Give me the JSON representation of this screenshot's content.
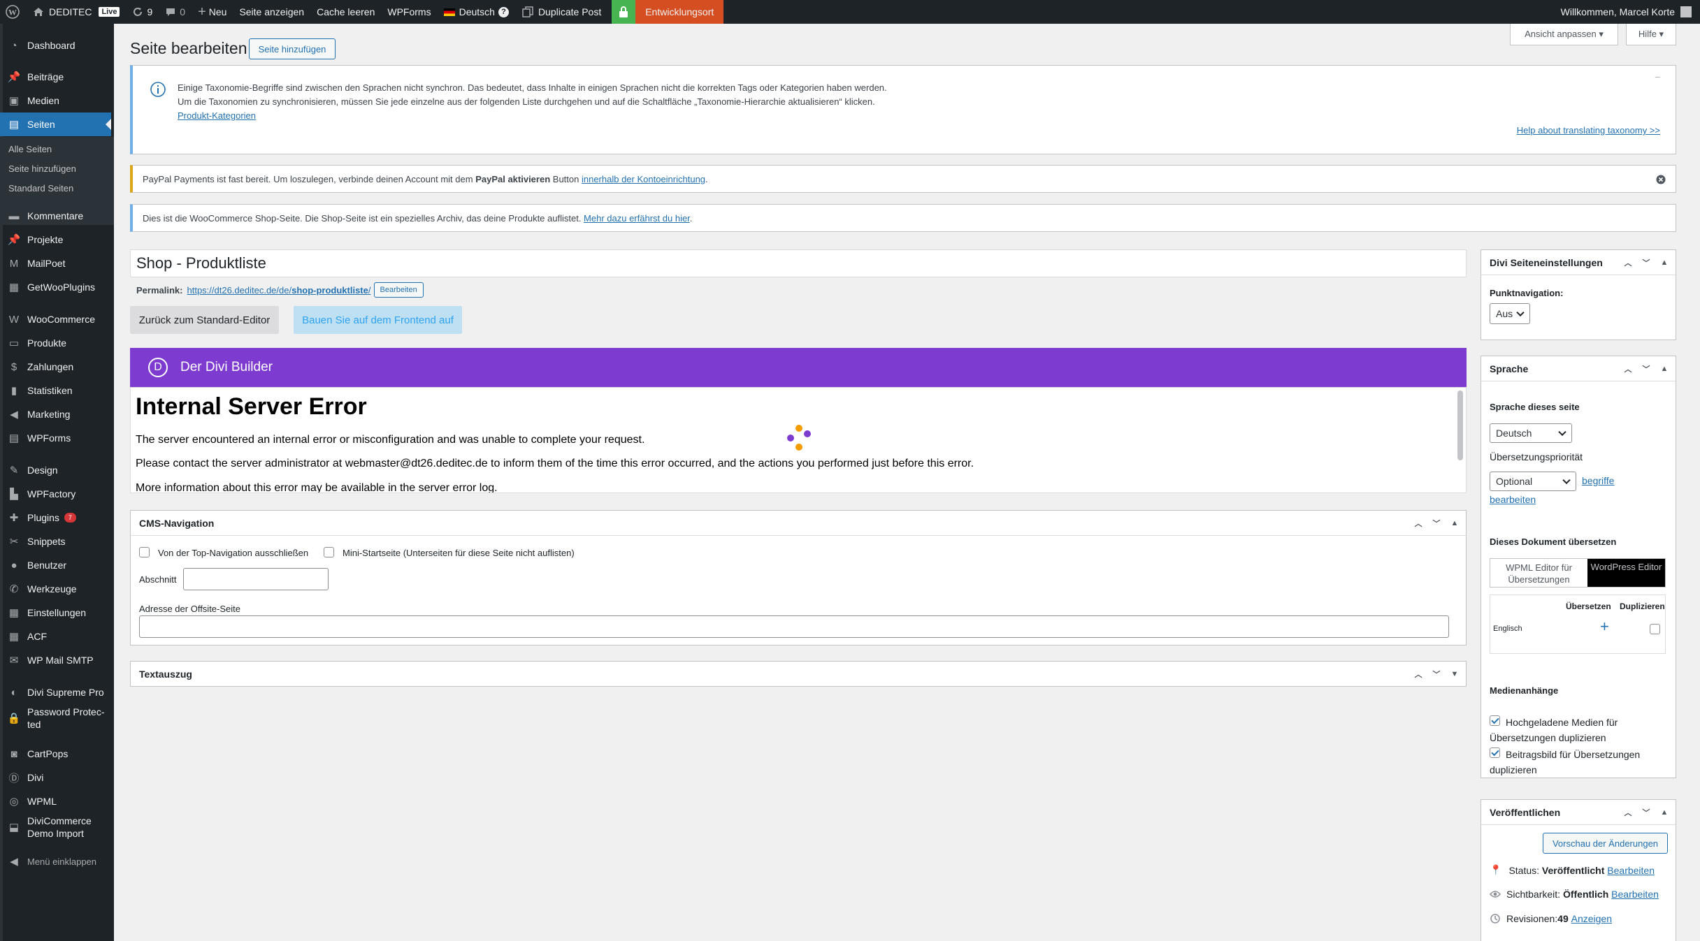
{
  "adminbar": {
    "site_name": "DEDITEC",
    "live_badge": "Live",
    "updates_count": "9",
    "comments_count": "0",
    "new_label": "Neu",
    "view_page": "Seite anzeigen",
    "clear_cache": "Cache leeren",
    "wpforms": "WPForms",
    "language": "Deutsch",
    "language_help": "?",
    "duplicate_post": "Duplicate Post",
    "environment": "Entwicklungsort",
    "greeting": "Willkommen, Marcel Korte",
    "colors": {
      "bar_bg": "#1d2327",
      "lock_bg": "#46b450",
      "env_bg": "#d54e21"
    }
  },
  "menu": {
    "items": [
      {
        "label": "Dashboard",
        "icon": "dashboard-icon"
      },
      {
        "label": "Beiträge",
        "icon": "pin-icon"
      },
      {
        "label": "Medien",
        "icon": "media-icon"
      },
      {
        "label": "Seiten",
        "icon": "pages-icon"
      },
      {
        "label": "Kommentare",
        "icon": "comments-icon"
      },
      {
        "label": "Projekte",
        "icon": "pin-icon"
      },
      {
        "label": "MailPoet",
        "icon": "mailpoet-icon"
      },
      {
        "label": "GetWooPlugins",
        "icon": "grid-icon"
      },
      {
        "label": "WooCommerce",
        "icon": "woo-icon"
      },
      {
        "label": "Produkte",
        "icon": "archive-icon"
      },
      {
        "label": "Zahlungen",
        "icon": "dollar-icon"
      },
      {
        "label": "Statistiken",
        "icon": "chart-icon"
      },
      {
        "label": "Marketing",
        "icon": "megaphone-icon"
      },
      {
        "label": "WPForms",
        "icon": "forms-icon"
      },
      {
        "label": "Design",
        "icon": "brush-icon"
      },
      {
        "label": "WPFactory",
        "icon": "factory-icon"
      },
      {
        "label": "Plugins",
        "icon": "plugin-icon",
        "badge": "7"
      },
      {
        "label": "Snippets",
        "icon": "snippets-icon"
      },
      {
        "label": "Benutzer",
        "icon": "user-icon"
      },
      {
        "label": "Werkzeuge",
        "icon": "wrench-icon"
      },
      {
        "label": "Einstellungen",
        "icon": "settings-icon"
      },
      {
        "label": "ACF",
        "icon": "grid-icon"
      },
      {
        "label": "WP Mail SMTP",
        "icon": "mail-icon"
      },
      {
        "label": "Divi Supreme Pro",
        "icon": "divi-supreme-icon"
      },
      {
        "label": "Password Protec-",
        "label2": "ted",
        "icon": "lock-icon"
      },
      {
        "label": "CartPops",
        "icon": "cartpops-icon"
      },
      {
        "label": "Divi",
        "icon": "divi-icon"
      },
      {
        "label": "WPML",
        "icon": "wpml-icon"
      },
      {
        "label": "DiviCommerce",
        "label2": "Demo Import",
        "icon": "import-icon"
      },
      {
        "label": "Menü einklappen",
        "icon": "collapse-icon"
      }
    ],
    "submenu": [
      "Alle Seiten",
      "Seite hinzufügen",
      "Standard Seiten"
    ]
  },
  "header": {
    "title": "Seite bearbeiten",
    "add_page": "Seite hinzufügen",
    "screen_options": "Ansicht anpassen ▾",
    "help": "Hilfe ▾"
  },
  "notices": {
    "taxonomy": {
      "line1": "Einige Taxonomie-Begriffe sind zwischen den Sprachen nicht synchron. Das bedeutet, dass Inhalte in einigen Sprachen nicht die korrekten Tags oder Kategorien haben werden.",
      "line2": "Um die Taxonomien zu synchronisieren, müssen Sie jede einzelne aus der folgenden Liste durchgehen und auf die Schaltfläche „Taxonomie-Hierarchie aktualisieren“ klicken.",
      "link": "Produkt-Kategorien",
      "help_link": "Help about translating taxonomy >>",
      "dismiss": "–"
    },
    "paypal": {
      "pre": "PayPal Payments ist fast bereit. Um loszulegen, verbinde deinen Account mit dem ",
      "bold": "PayPal aktivieren",
      "mid": " Button ",
      "link": "innerhalb der Kontoeinrichtung",
      "post": "."
    },
    "shop": {
      "text": "Dies ist die WooCommerce Shop-Seite. Die Shop-Seite ist ein spezielles Archiv, das deine Produkte auflistet. ",
      "link": "Mehr dazu erfährst du hier",
      "post": "."
    }
  },
  "editor": {
    "title": "Shop - Produktliste",
    "permalink_label": "Permalink:",
    "permalink_base": "https://dt26.deditec.de/de/",
    "permalink_slug": "shop-produktliste",
    "permalink_end": "/",
    "permalink_edit": "Bearbeiten",
    "back_button": "Zurück zum Standard-Editor",
    "frontend_button": "Bauen Sie auf dem Frontend auf"
  },
  "divi": {
    "logo": "D",
    "title": "Der Divi Builder",
    "error_title": "Internal Server Error",
    "error_p1": "The server encountered an internal error or misconfiguration and was unable to complete your request.",
    "error_p2": "Please contact the server administrator at webmaster@dt26.deditec.de to inform them of the time this error occurred, and the actions you performed just before this error.",
    "error_p3": "More information about this error may be available in the server error log.",
    "loader_colors": [
      "#7e3bd0",
      "#f59c00",
      "#7e3bd0",
      "#f59c00"
    ]
  },
  "cms_nav": {
    "title": "CMS-Navigation",
    "exclude_top": "Von der Top-Navigation ausschließen",
    "mini_home": "Mini-Startseite (Unterseiten für diese Seite nicht auflisten)",
    "section_label": "Abschnitt",
    "section_value": "",
    "offsite_label": "Adresse der Offsite-Seite",
    "offsite_value": ""
  },
  "excerpt": {
    "title": "Textauszug"
  },
  "sidebar": {
    "divi_settings": {
      "title": "Divi Seiteneinstellungen",
      "dot_nav_label": "Punktnavigation:",
      "dot_nav_value": "Aus"
    },
    "language": {
      "title": "Sprache",
      "page_lang_label": "Sprache dieses seite",
      "page_lang_value": "Deutsch",
      "priority_label": "Übersetzungspriorität",
      "priority_value": "Optional",
      "edit_terms_1": "begriffe",
      "edit_terms_2": "bearbeiten",
      "translate_label": "Dieses Dokument übersetzen",
      "tab_wpml": "WPML Editor für Übersetzungen",
      "tab_wp": "WordPress Editor",
      "col_translate": "Übersetzen",
      "col_duplicate": "Duplizieren",
      "lang_row": "Englisch",
      "media_label": "Medienanhänge",
      "media_opt1": "Hochgeladene Medien für Übersetzungen duplizieren",
      "media_opt2": "Beitragsbild für Übersetzungen duplizieren"
    },
    "publish": {
      "title": "Veröffentlichen",
      "preview": "Vorschau der Änderungen",
      "status_label": "Status: ",
      "status_value": "Veröffentlicht",
      "status_edit": "Bearbeiten",
      "visibility_label": "Sichtbarkeit: ",
      "visibility_value": "Öffentlich",
      "visibility_edit": "Bearbeiten",
      "revisions_label": "Revisionen: ",
      "revisions_value": "49",
      "revisions_link": "Anzeigen"
    }
  }
}
